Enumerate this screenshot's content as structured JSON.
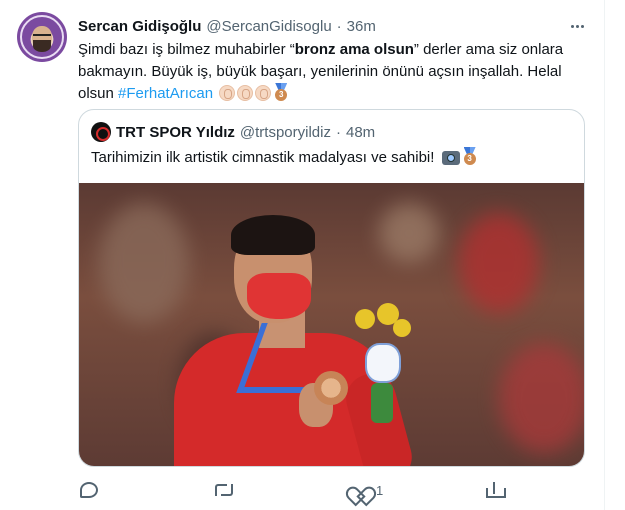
{
  "tweet": {
    "author_name": "Sercan Gidişoğlu",
    "author_handle": "@SercanGidisoglu",
    "separator": "·",
    "time": "36m",
    "text_before_bold": "Şimdi bazı iş bilmez muhabirler “",
    "text_bold": "bronz ama olsun",
    "text_after_bold": "” derler ama siz onlara bakmayın. Büyük iş, büyük başarı, yenilerinin önünü açsın inşallah. Helal olsun ",
    "hashtag": "#FerhatArıcan",
    "emojis": [
      "clapping-hands",
      "clapping-hands",
      "clapping-hands",
      "3rd-place-medal"
    ]
  },
  "quoted": {
    "author_name": "TRT SPOR Yıldız",
    "author_handle": "@trtsporyildiz",
    "separator": "·",
    "time": "48m",
    "text": "Tarihimizin ilk artistik cimnastik madalyası ve sahibi! ",
    "emojis": [
      "camera-with-flash",
      "3rd-place-medal"
    ]
  },
  "actions": {
    "reply_count": "",
    "retweet_count": "",
    "like_count": "1",
    "share_count": ""
  },
  "colors": {
    "link": "#1d9bf0",
    "secondary_text": "#536471",
    "border": "#cfd9de"
  }
}
